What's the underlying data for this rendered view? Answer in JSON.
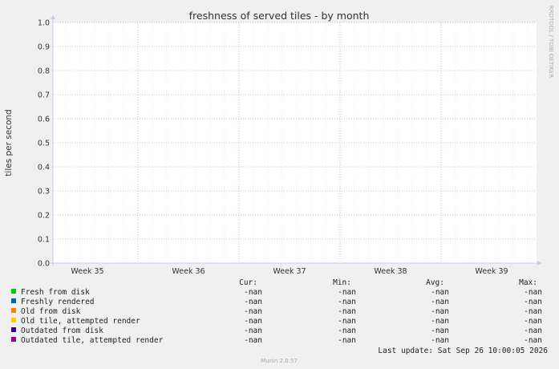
{
  "chart_data": {
    "type": "area",
    "title": "freshness of served tiles - by month",
    "ylabel": "tiles per second",
    "ylim": [
      0,
      1
    ],
    "yticks": [
      "0.0",
      "0.1",
      "0.2",
      "0.3",
      "0.4",
      "0.5",
      "0.6",
      "0.7",
      "0.8",
      "0.9",
      "1.0"
    ],
    "x_labels": [
      "Week 35",
      "Week 36",
      "Week 37",
      "Week 38",
      "Week 39"
    ],
    "grid": true,
    "series": [
      {
        "name": "Fresh from disk",
        "color": "#00cc00",
        "cur": "-nan",
        "min": "-nan",
        "avg": "-nan",
        "max": "-nan"
      },
      {
        "name": "Freshly rendered",
        "color": "#0066b3",
        "cur": "-nan",
        "min": "-nan",
        "avg": "-nan",
        "max": "-nan"
      },
      {
        "name": "Old from disk",
        "color": "#ff8000",
        "cur": "-nan",
        "min": "-nan",
        "avg": "-nan",
        "max": "-nan"
      },
      {
        "name": "Old tile, attempted render",
        "color": "#ffcc00",
        "cur": "-nan",
        "min": "-nan",
        "avg": "-nan",
        "max": "-nan"
      },
      {
        "name": "Outdated from disk",
        "color": "#330099",
        "cur": "-nan",
        "min": "-nan",
        "avg": "-nan",
        "max": "-nan"
      },
      {
        "name": "Outdated tile, attempted render",
        "color": "#990099",
        "cur": "-nan",
        "min": "-nan",
        "avg": "-nan",
        "max": "-nan"
      }
    ]
  },
  "legend_headers": {
    "cur": "Cur:",
    "min": "Min:",
    "avg": "Avg:",
    "max": "Max:"
  },
  "last_update": "Last update: Sat Sep 26 10:00:05 2026",
  "watermark": "RRDTOOL / TOBI OETIKER",
  "footer": "Munin 2.0.57"
}
